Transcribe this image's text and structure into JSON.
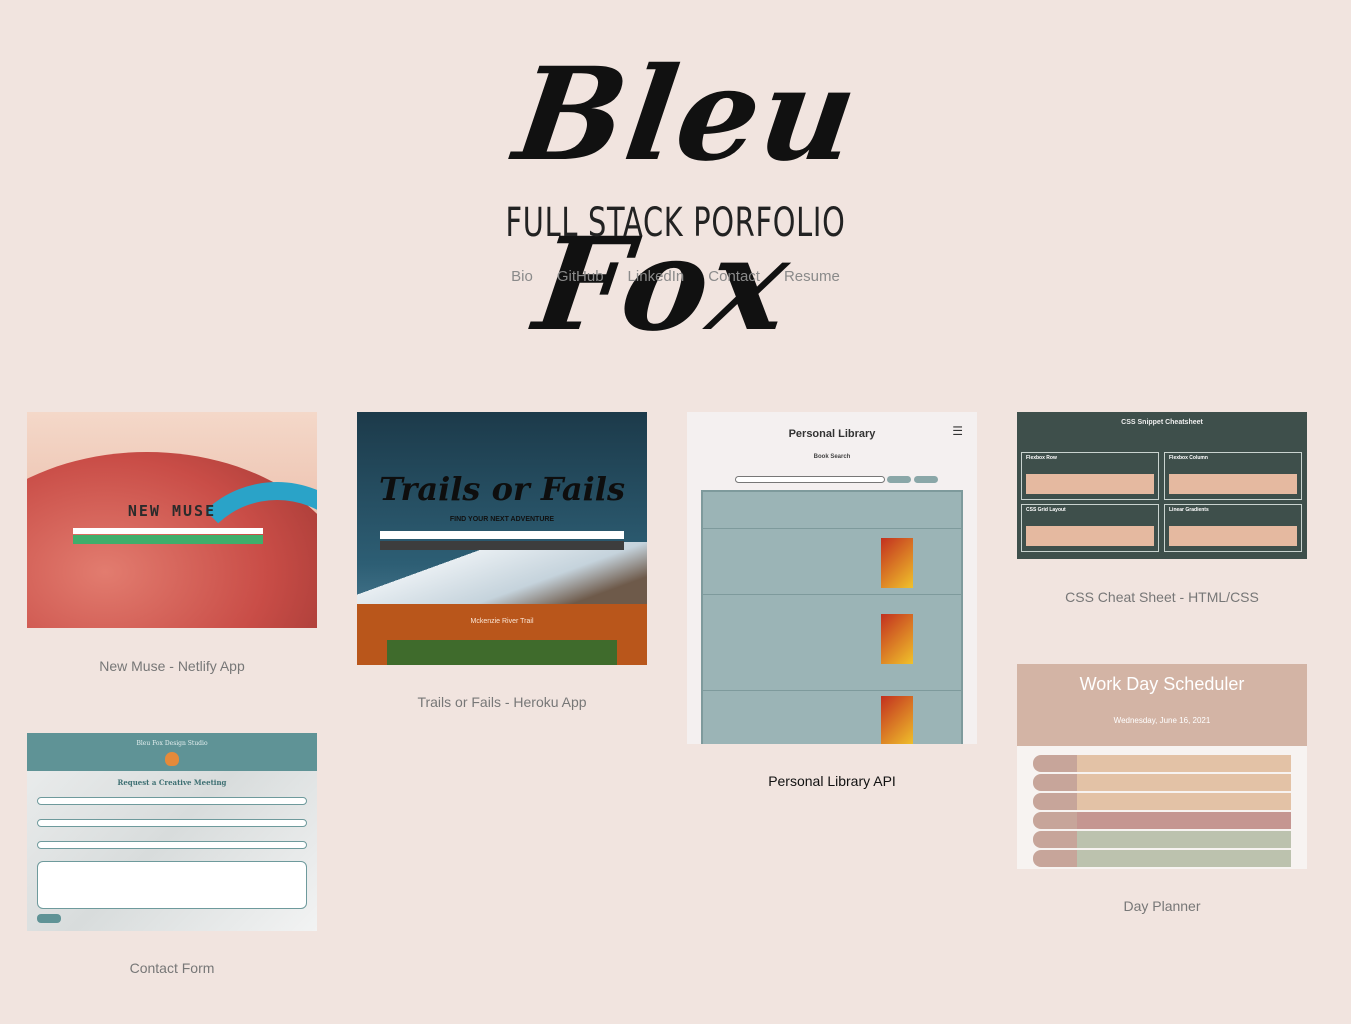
{
  "header": {
    "logo_text": "Bleu Fox",
    "subtitle": "FULL STACK PORFOLIO",
    "nav": [
      "Bio",
      "GitHub",
      "LinkedIn",
      "Contact",
      "Resume"
    ]
  },
  "projects": [
    {
      "caption": "New Muse - Netlify App",
      "thumb_title": "NEW MUSE"
    },
    {
      "caption": "Trails or Fails - Heroku App",
      "thumb_title": "Trails or Fails",
      "thumb_tagline": "FIND YOUR NEXT ADVENTURE",
      "thumb_location": "Mckenzie River Trail"
    },
    {
      "caption": "Personal Library API",
      "thumb_title": "Personal Library",
      "thumb_subtitle": "Book Search"
    },
    {
      "caption": "CSS Cheat Sheet - HTML/CSS",
      "thumb_title": "CSS Snippet Cheatsheet",
      "thumb_boxes": [
        "Flexbox Row",
        "Flexbox Column",
        "CSS Grid Layout",
        "Linear Gradients"
      ]
    },
    {
      "caption": "Day Planner",
      "thumb_title": "Work Day Scheduler",
      "thumb_date": "Wednesday, June 16, 2021"
    },
    {
      "caption": "Contact Form",
      "thumb_title": "Bleu Fox Design Studio",
      "thumb_subtitle": "Request a Creative Meeting"
    }
  ],
  "colors": {
    "background": "#f1e4df",
    "caption": "#777777",
    "nav": "#8a8a8a",
    "highlight_caption": "#111111"
  }
}
